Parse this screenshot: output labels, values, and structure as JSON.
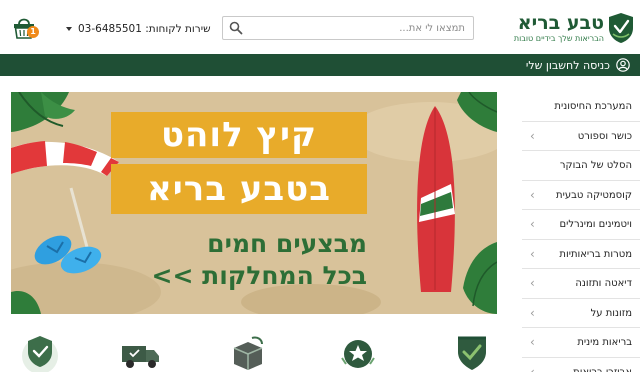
{
  "header": {
    "logo_name": "טבע בריא",
    "logo_tagline": "הבריאות שלך בידיים טובות",
    "search_placeholder": "תמצאו לי את...",
    "service_label": "שירות לקוחות: 03-6485501",
    "cart_count": "1"
  },
  "topbar": {
    "login_label": "כניסה לחשבון שלי"
  },
  "banner": {
    "headline_line1": "קיץ לוהט",
    "headline_line2": "בטבע בריא",
    "promo_line1": "מבצעים חמים",
    "promo_line2": "בכל המחלקות >>"
  },
  "sidebar": {
    "items": [
      {
        "label": "המערכת החיסונית",
        "has_arrow": false
      },
      {
        "label": "כושר וספורט",
        "has_arrow": true
      },
      {
        "label": "הסלט של הבוקר",
        "has_arrow": false
      },
      {
        "label": "קוסמטיקה טבעית",
        "has_arrow": true
      },
      {
        "label": "ויטמינים ומינרלים",
        "has_arrow": true
      },
      {
        "label": "מטרות בריאותיות",
        "has_arrow": true
      },
      {
        "label": "דיאטה ותזונה",
        "has_arrow": true
      },
      {
        "label": "מזונות על",
        "has_arrow": true
      },
      {
        "label": "בריאות מינית",
        "has_arrow": true
      },
      {
        "label": "אביזרי בריאות",
        "has_arrow": true
      }
    ]
  },
  "features": {
    "icons": [
      "shield-check-icon",
      "star-badge-icon",
      "package-box-icon",
      "delivery-truck-icon",
      "checkmark-badge-icon"
    ]
  },
  "colors": {
    "brand_green": "#1f4f35",
    "accent_orange": "#e8ab2a",
    "promo_green": "#2d6e36",
    "badge_orange": "#f08a1a"
  }
}
